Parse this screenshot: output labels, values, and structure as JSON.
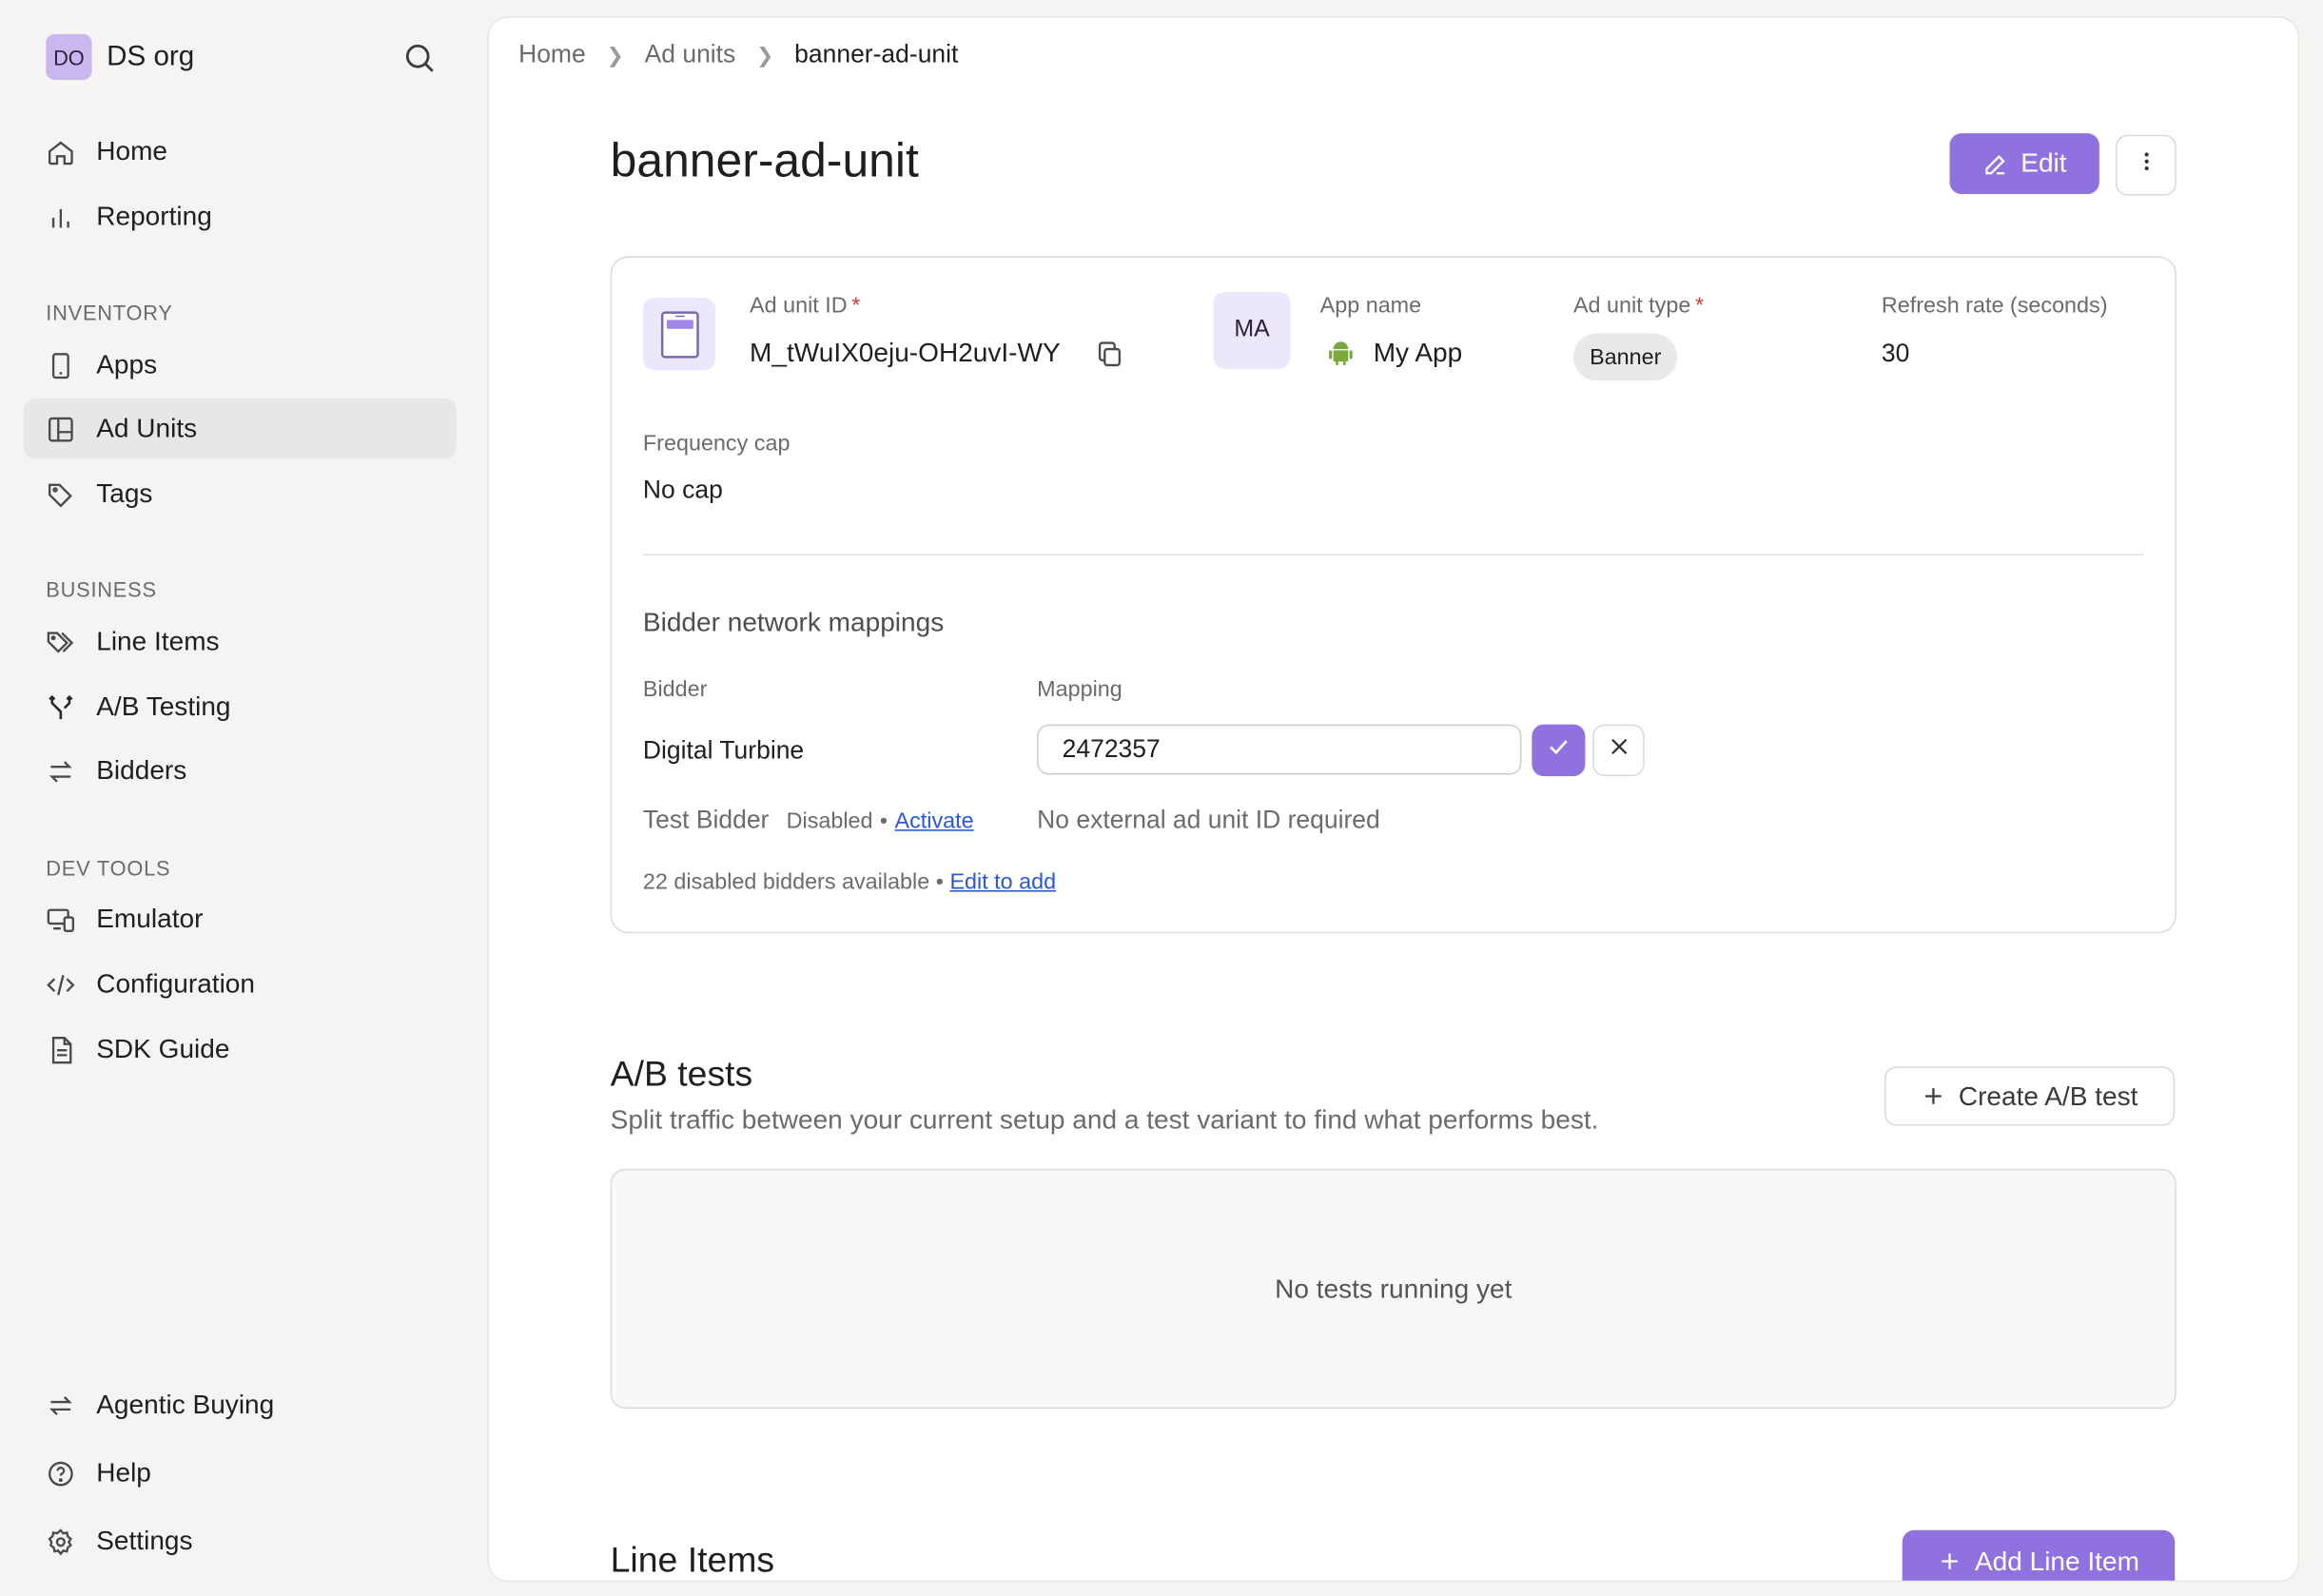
{
  "org": {
    "initials": "DO",
    "name": "DS org"
  },
  "nav": {
    "top": [
      {
        "label": "Home"
      },
      {
        "label": "Reporting"
      }
    ],
    "inventory_label": "INVENTORY",
    "inventory": [
      {
        "label": "Apps"
      },
      {
        "label": "Ad Units"
      },
      {
        "label": "Tags"
      }
    ],
    "business_label": "BUSINESS",
    "business": [
      {
        "label": "Line Items"
      },
      {
        "label": "A/B Testing"
      },
      {
        "label": "Bidders"
      }
    ],
    "devtools_label": "DEV TOOLS",
    "devtools": [
      {
        "label": "Emulator"
      },
      {
        "label": "Configuration"
      },
      {
        "label": "SDK Guide"
      }
    ],
    "bottom": [
      {
        "label": "Agentic Buying"
      },
      {
        "label": "Help"
      },
      {
        "label": "Settings"
      }
    ],
    "active": "Ad Units"
  },
  "breadcrumb": [
    "Home",
    "Ad units",
    "banner-ad-unit"
  ],
  "page": {
    "title": "banner-ad-unit",
    "edit_label": "Edit"
  },
  "details": {
    "ad_unit_id_label": "Ad unit ID",
    "ad_unit_id": "M_tWuIX0eju-OH2uvI-WY",
    "app_initials": "MA",
    "app_name_label": "App name",
    "app_name": "My App",
    "ad_unit_type_label": "Ad unit type",
    "ad_unit_type": "Banner",
    "refresh_rate_label": "Refresh rate (seconds)",
    "refresh_rate": "30",
    "frequency_cap_label": "Frequency cap",
    "frequency_cap": "No cap",
    "required_mark": "*"
  },
  "bidders": {
    "section_title": "Bidder network mappings",
    "col_bidder": "Bidder",
    "col_mapping": "Mapping",
    "rows": [
      {
        "name": "Digital Turbine",
        "mapping_value": "2472357"
      },
      {
        "name": "Test Bidder",
        "status": "Disabled",
        "dot": "•",
        "action": "Activate",
        "note": "No external ad unit ID required"
      }
    ],
    "footer_text": "22 disabled bidders available",
    "footer_dot": "•",
    "footer_link": "Edit to add"
  },
  "ab_tests": {
    "title": "A/B tests",
    "subtitle": "Split traffic between your current setup and a test variant to find what performs best.",
    "create_label": "Create A/B test",
    "empty_text": "No tests running yet"
  },
  "line_items": {
    "title": "Line Items",
    "add_label": "Add Line Item"
  },
  "colors": {
    "accent": "#9071e0",
    "link": "#2a57d6",
    "required": "#d63a3a",
    "android": "#78a93a"
  }
}
